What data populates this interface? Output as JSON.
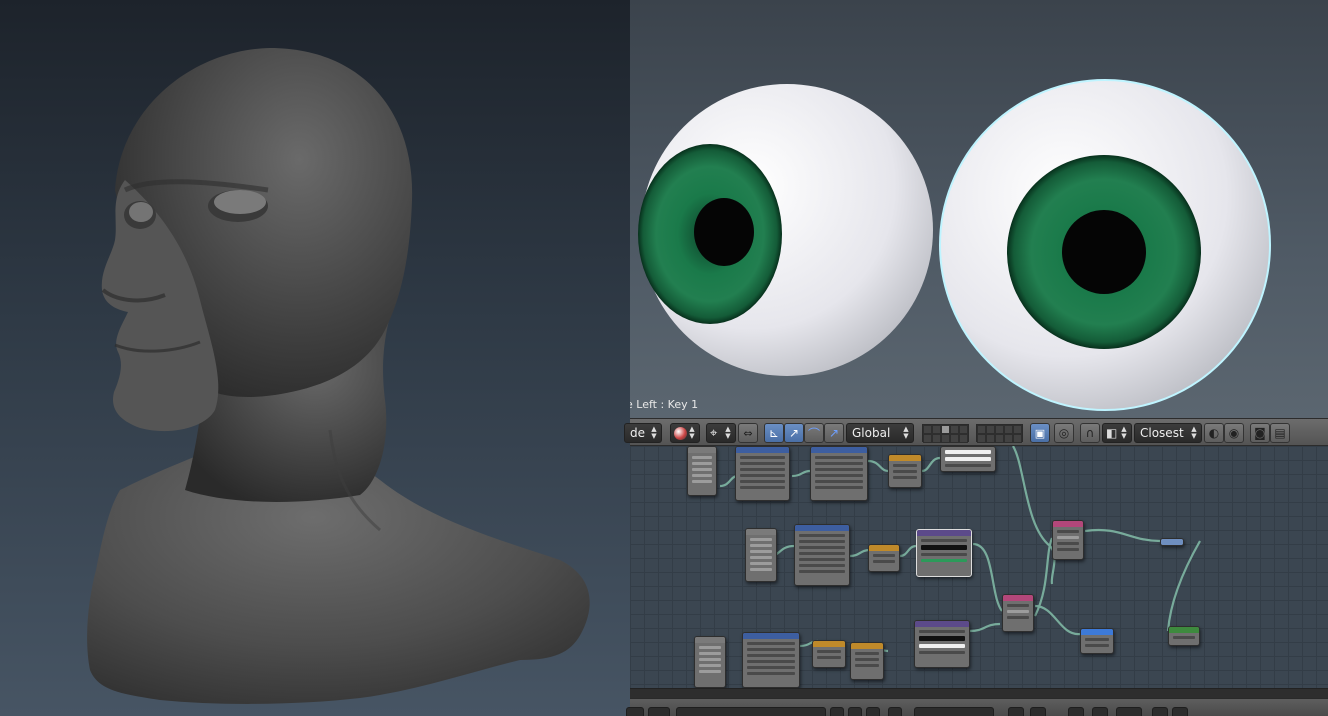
{
  "viewport": {
    "info_text": "e Left : Key 1"
  },
  "header": {
    "mode_label": "de",
    "transform_orientation": "Global",
    "snap_element": "Closest"
  },
  "colors": {
    "iris": "#1a7a4a",
    "sclera": "#f2f2f6",
    "sculpt_clay": "#4a4a4a",
    "selection_outline": "#bff4ff"
  },
  "icons": {
    "pivot": "pivot-point-icon",
    "manipulator_translate": "translate-manipulator-icon",
    "manipulator_rotate": "rotate-manipulator-icon",
    "manipulator_scale": "scale-manipulator-icon",
    "snap": "magnet-icon",
    "render": "camera-icon"
  }
}
